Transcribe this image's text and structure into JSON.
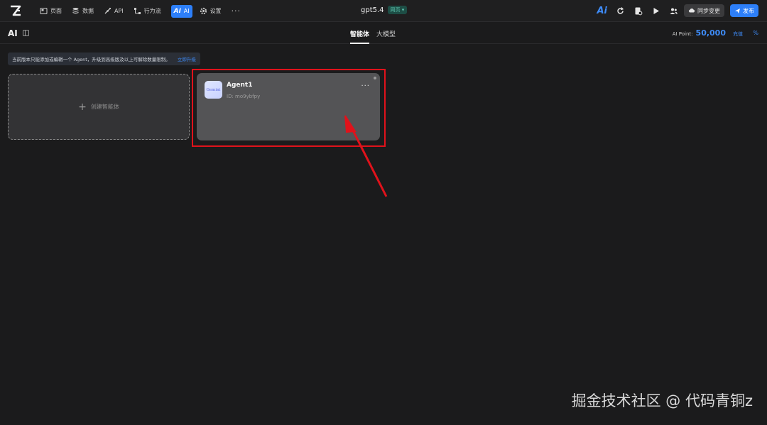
{
  "nav": {
    "items": [
      {
        "label": "页面",
        "icon": "page-icon"
      },
      {
        "label": "数据",
        "icon": "database-icon"
      },
      {
        "label": "API",
        "icon": "api-icon"
      },
      {
        "label": "行为流",
        "icon": "flow-icon"
      },
      {
        "label": "AI",
        "icon": "ai-icon",
        "active": true
      },
      {
        "label": "设置",
        "icon": "gear-icon"
      }
    ],
    "more": "···",
    "ai_badge": "Ai"
  },
  "project": {
    "name": "gpt5.4",
    "tag": "网页 ▾"
  },
  "toolbar": {
    "ai_logo": "Ai",
    "sync_label": "同步变更",
    "publish_label": "发布"
  },
  "page": {
    "title": "AI",
    "tabs": [
      {
        "label": "智能体",
        "active": true
      },
      {
        "label": "大模型",
        "active": false
      }
    ],
    "points_label": "AI Point:",
    "points_value": "50,000",
    "recharge_label": "充值"
  },
  "notice": {
    "message": "当前版本只能添加或编辑一个 Agent，升级到高级版及以上可解除数量限制。",
    "action": "立即升级"
  },
  "create_card": {
    "plus": "+",
    "label": "创建智能体"
  },
  "agent": {
    "name": "Agent1",
    "id": "ID: mo9ybfpy",
    "avatar_text": "Gemini",
    "more": "···"
  },
  "watermark": "掘金技术社区 @ 代码青铜z",
  "colors": {
    "accent": "#2d7ff9",
    "highlight": "#e0121b",
    "background": "#1b1b1c"
  }
}
